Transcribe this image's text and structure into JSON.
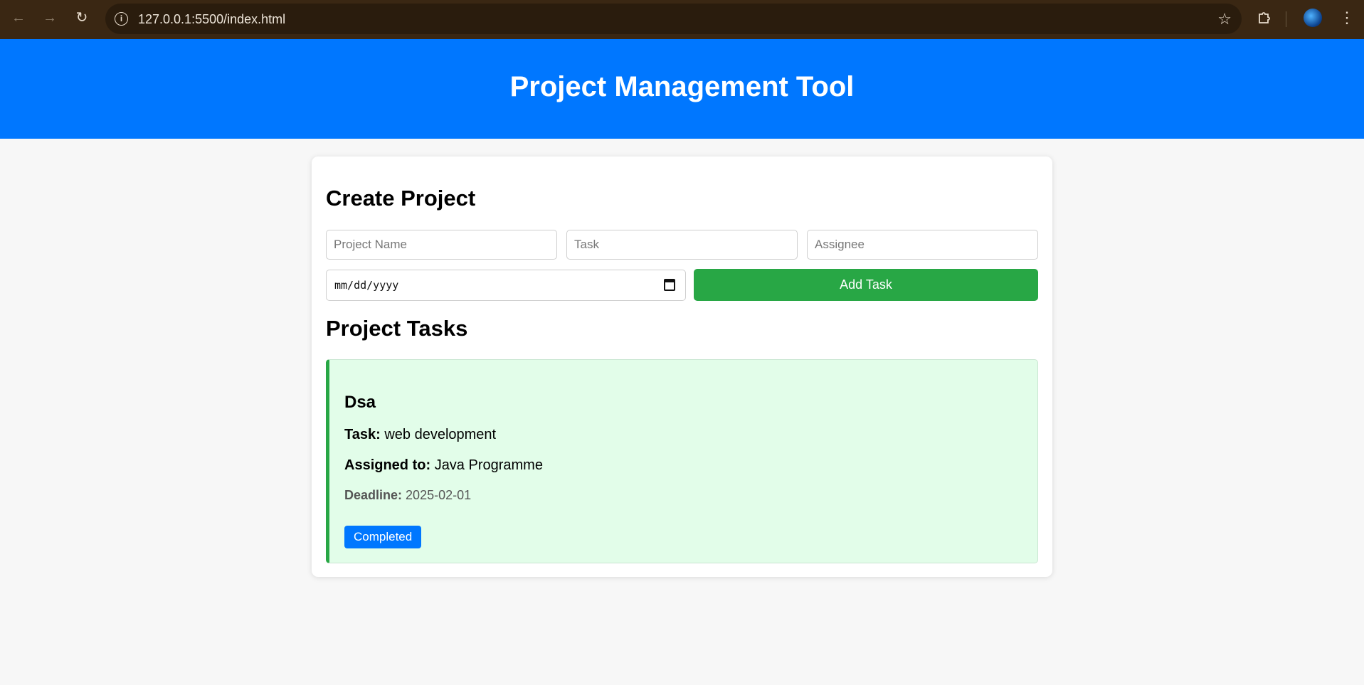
{
  "browser": {
    "url": "127.0.0.1:5500/index.html"
  },
  "app": {
    "title": "Project Management Tool"
  },
  "create": {
    "heading": "Create Project",
    "project_name_placeholder": "Project Name",
    "task_placeholder": "Task",
    "assignee_placeholder": "Assignee",
    "date_placeholder": "mm/dd/yyyy",
    "add_button": "Add Task"
  },
  "tasks": {
    "heading": "Project Tasks",
    "items": [
      {
        "project": "Dsa",
        "task_label": "Task:",
        "task": "web development",
        "assignee_label": "Assigned to:",
        "assignee": "Java Programme",
        "deadline_label": "Deadline:",
        "deadline": "2025-02-01",
        "status": "Completed"
      }
    ]
  },
  "colors": {
    "header": "#0077ff",
    "add_button": "#28a745",
    "task_background": "#e2fde9",
    "status_badge": "#0077ff"
  }
}
